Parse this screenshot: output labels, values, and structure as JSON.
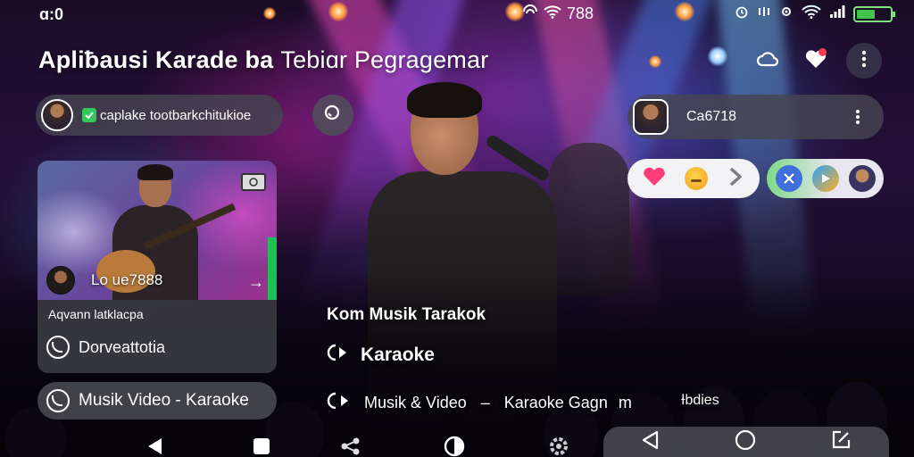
{
  "status_bar": {
    "time": "ɑ:0",
    "center_text": "788",
    "center_icons": [
      "network-icon",
      "wifi-icon"
    ],
    "right_icons": [
      "alarm-icon",
      "sync-icon",
      "settings-status-icon",
      "wifi-icon",
      "signal-icon",
      "battery-icon"
    ],
    "battery_level": 0.55
  },
  "header": {
    "title_main": "Apliƀausi Karade ba",
    "title_sub": "Tebiɑr Pegragemar",
    "icons": [
      "cloud-icon",
      "heart-notification-icon",
      "more-vert-icon"
    ]
  },
  "user_pill": {
    "handle": "caplake tootbarkchitukioe",
    "badge_icon": "verified-badge-icon"
  },
  "search": {
    "icon": "search-icon"
  },
  "code_pill": {
    "code": "Ca6718"
  },
  "reactions": {
    "icons": [
      "heart-icon",
      "emoji-face-icon",
      "forward-icon"
    ]
  },
  "share": {
    "icons": [
      "close-cross-icon",
      "play-icon",
      "profile-icon"
    ]
  },
  "video_card": {
    "stat": "Lo ue7888",
    "caption": "Aqvann latklacpa",
    "action_label": "Dorveattotia"
  },
  "music_video_pill": {
    "label": "Musik Video - Karaoke"
  },
  "center": {
    "subtitle": "Kom Musik Tarakok",
    "karaoke_label": "Karaoke",
    "bottom_left": "Musik & Video",
    "bottom_dash": "–",
    "bottom_right": "Karaoke Gagn",
    "bottom_tail": "m"
  },
  "right_label": "Ɨbdies",
  "colors": {
    "accent_green": "#34c759",
    "notification_red": "#ff3b4e",
    "pill_bg": "#46464f",
    "heart_pink": "#ff3d7a"
  }
}
